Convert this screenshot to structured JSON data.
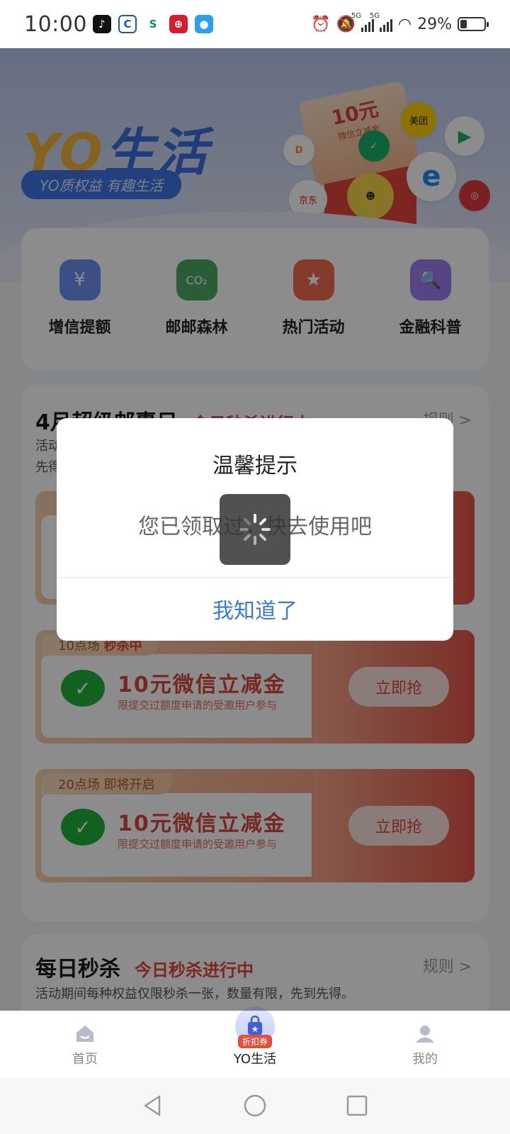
{
  "status": {
    "time": "10:00",
    "battery": "29%",
    "network": "5G"
  },
  "banner": {
    "brand_yo": "YO",
    "brand_life": "生活",
    "slogan": "YO质权益 有趣生活",
    "coupon_amount": "10元",
    "coupon_sub": "微信立减金",
    "partners": [
      "美团",
      "京东"
    ]
  },
  "quick_menu": [
    {
      "label": "增信提额",
      "icon": "wallet-icon",
      "color": "#6f8ff0"
    },
    {
      "label": "邮邮森林",
      "icon": "co2-cloud-icon",
      "color": "#4caa63"
    },
    {
      "label": "热门活动",
      "icon": "bookmark-star-icon",
      "color": "#ef6b4f"
    },
    {
      "label": "金融科普",
      "icon": "document-search-icon",
      "color": "#9d7cf0"
    }
  ],
  "promo": {
    "title": "4月超级邮惠日",
    "badge": "今日秒杀进行中",
    "rule": "规则 >",
    "desc_line1": "活动",
    "desc_line2": "先得",
    "deals": [
      {
        "session": "10点场",
        "state": "秒杀中",
        "title": "10元微信立减金",
        "sub": "限提交过额度申请的受邀用户参与",
        "button": "立即抢"
      },
      {
        "session": "20点场 即将开启",
        "state": "",
        "title": "10元微信立减金",
        "sub": "限提交过额度申请的受邀用户参与",
        "button": "立即抢"
      }
    ]
  },
  "flash": {
    "title": "每日秒杀",
    "badge": "今日秒杀进行中",
    "rule": "规则 >",
    "desc": "活动期间每种权益仅限秒杀一张，数量有限，先到先得。"
  },
  "dialog": {
    "title": "温馨提示",
    "message": "您已领取过，快去使用吧",
    "confirm": "我知道了"
  },
  "bottom_nav": {
    "home": "首页",
    "yo_life": "YO生活",
    "yo_tag": "折扣券",
    "mine": "我的"
  },
  "colors": {
    "accent_red": "#e0463a",
    "link_blue": "#3d7ad6",
    "wechat_green": "#1fb23b"
  }
}
